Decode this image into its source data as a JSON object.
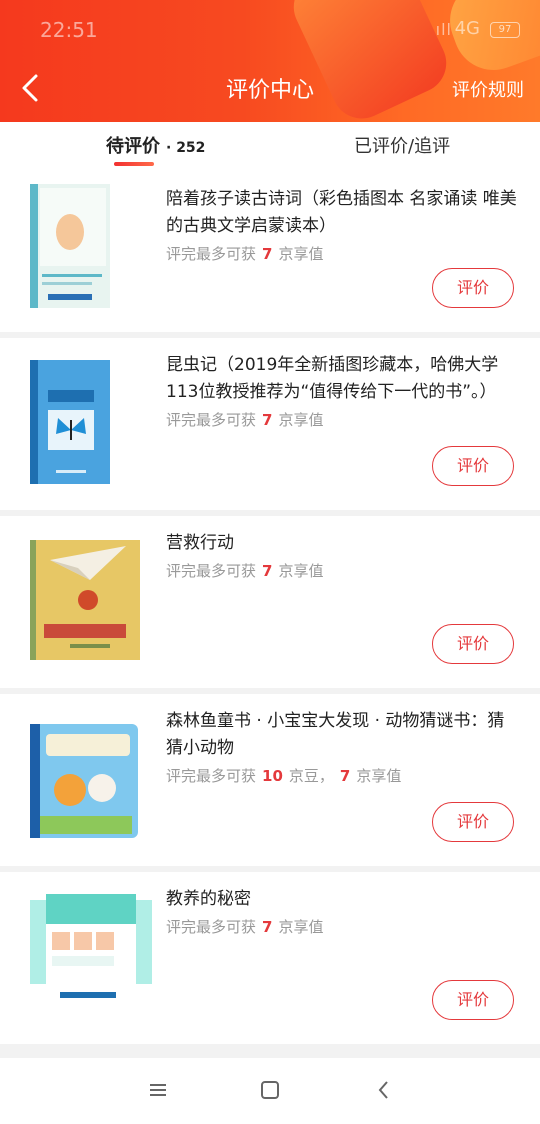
{
  "status_bar": {
    "time": "22:51",
    "network": "4G",
    "battery": "97"
  },
  "header": {
    "title": "评价中心",
    "rules": "评价规则"
  },
  "tabs": [
    {
      "label": "待评价",
      "count": "· 252"
    },
    {
      "label": "已评价/追评"
    }
  ],
  "items": [
    {
      "name": "陪着孩子读古诗词（彩色插图本 名家诵读 唯美的古典文学启蒙读本）",
      "reward_prefix": "评完最多可获",
      "num1": "7",
      "unit1": "京享值",
      "button": "评价"
    },
    {
      "name": "昆虫记（2019年全新插图珍藏本，哈佛大学113位教授推荐为“值得传给下一代的书”。）",
      "reward_prefix": "评完最多可获",
      "num1": "7",
      "unit1": "京享值",
      "button": "评价"
    },
    {
      "name": "营救行动",
      "reward_prefix": "评完最多可获",
      "num1": "7",
      "unit1": "京享值",
      "button": "评价"
    },
    {
      "name": "森林鱼童书 · 小宝宝大发现 · 动物猜谜书：猜猜小动物",
      "reward_prefix": "评完最多可获",
      "num1": "10",
      "unit1": "京豆，",
      "num2": "7",
      "unit2": "京享值",
      "button": "评价"
    },
    {
      "name": "教养的秘密",
      "reward_prefix": "评完最多可获",
      "num1": "7",
      "unit1": "京享值",
      "button": "评价"
    }
  ],
  "covers": [
    {
      "icon": "book-cover-poetry",
      "text": "陪着孩子读古诗词",
      "colors": [
        "#5db8c8",
        "#e8f4f0"
      ]
    },
    {
      "icon": "book-cover-insects",
      "text": "昆虫记",
      "colors": [
        "#4aa3df",
        "#1e6fb0"
      ]
    },
    {
      "icon": "book-cover-rescue",
      "text": "营救行动",
      "colors": [
        "#e7c765",
        "#c94a3a"
      ]
    },
    {
      "icon": "book-cover-animals",
      "text": "猜猜小动物",
      "colors": [
        "#7fc8ee",
        "#f3a23a"
      ]
    },
    {
      "icon": "book-cover-parenting",
      "text": "教养的秘密",
      "colors": [
        "#5fd3c4",
        "#ffffff"
      ]
    }
  ],
  "colors": {
    "accent": "#e4393c",
    "header": "#f74a20"
  }
}
